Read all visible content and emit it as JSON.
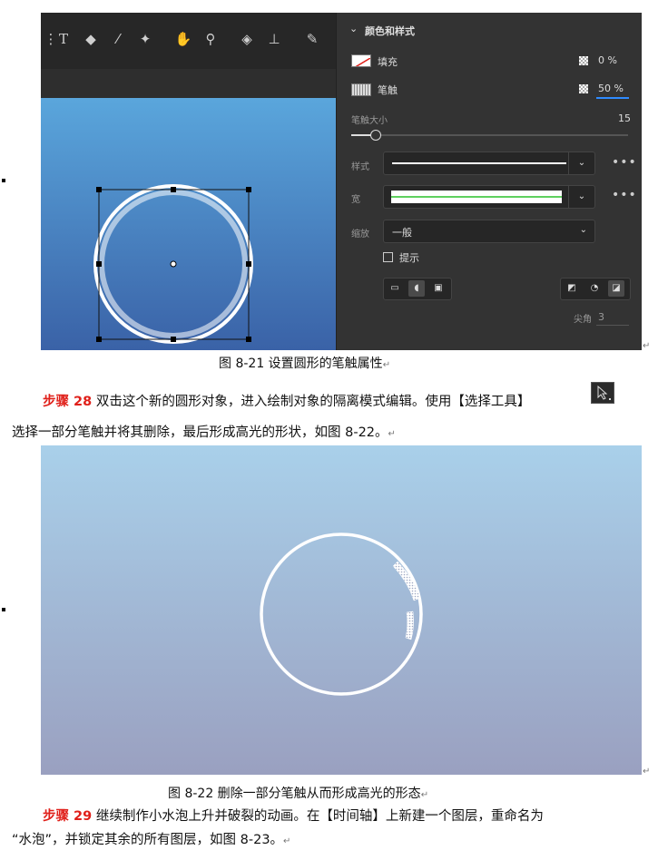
{
  "figure1": {
    "panel": {
      "section_title": "颜色和样式",
      "fill_label": "填充",
      "fill_alpha": "0 %",
      "stroke_label": "笔触",
      "stroke_alpha": "50 %",
      "stroke_size_label": "笔触大小",
      "stroke_size_value": "15",
      "style_label": "样式",
      "width_label": "宽",
      "scale_label": "缩放",
      "scale_value": "一般",
      "hint_label": "提示",
      "miter_label": "尖角",
      "miter_value": "3"
    },
    "caption": "图 8-21  设置圆形的笔触属性"
  },
  "step28": {
    "label": "步骤 28",
    "line1": "双击这个新的圆形对象，进入绘制对象的隔离模式编辑。使用【选择工具】",
    "line2": "选择一部分笔触并将其删除，最后形成高光的形状，如图 8-22。"
  },
  "figure2": {
    "caption": "图  8-22  删除一部分笔触从而形成高光的形态"
  },
  "step29": {
    "label": "步骤 29",
    "line1": "继续制作小水泡上升并破裂的动画。在【时间轴】上新建一个图层，重命名为",
    "line2": "“水泡”，并锁定其余的所有图层，如图 8-23。"
  },
  "marks": {
    "return": "↵"
  },
  "colors": {
    "step_label": "#e0201a",
    "accent_blue": "#2f8bff"
  }
}
